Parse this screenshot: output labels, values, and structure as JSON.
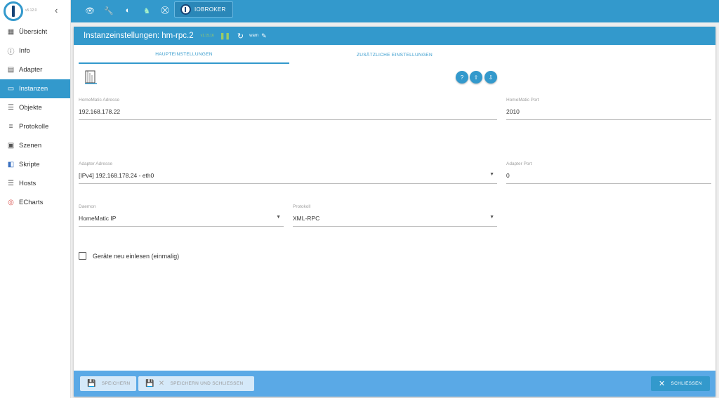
{
  "sidebar": {
    "version": "v5.12.0",
    "items": [
      {
        "label": "Übersicht",
        "icon": "grid-icon"
      },
      {
        "label": "Info",
        "icon": "info-icon"
      },
      {
        "label": "Adapter",
        "icon": "store-icon"
      },
      {
        "label": "Instanzen",
        "icon": "instances-icon"
      },
      {
        "label": "Objekte",
        "icon": "list-icon"
      },
      {
        "label": "Protokolle",
        "icon": "menu-icon"
      },
      {
        "label": "Szenen",
        "icon": "archive-icon"
      },
      {
        "label": "Skripte",
        "icon": "script-icon"
      },
      {
        "label": "Hosts",
        "icon": "storage-icon"
      },
      {
        "label": "ECharts",
        "icon": "echarts-icon"
      }
    ]
  },
  "topbar": {
    "brand": "IOBROKER",
    "icons": [
      "eye-icon",
      "wrench-icon",
      "brightness-icon",
      "expert-mode-icon",
      "no-connection-icon"
    ]
  },
  "panel": {
    "title": "Instanzeinstellungen: hm-rpc.2",
    "version": "v1.15.16",
    "log_level": "warn"
  },
  "tabs": [
    {
      "label": "HAUPTEINSTELLUNGEN",
      "active": true
    },
    {
      "label": "ZUSÄTZLICHE EINSTELLUNGEN",
      "active": false
    }
  ],
  "fields": {
    "homematic_address": {
      "label": "HomeMatic Adresse",
      "value": "192.168.178.22"
    },
    "homematic_port": {
      "label": "HomeMatic Port",
      "value": "2010"
    },
    "adapter_address": {
      "label": "Adapter Adresse",
      "value": "[IPv4] 192.168.178.24 - eth0"
    },
    "adapter_port": {
      "label": "Adapter Port",
      "value": "0"
    },
    "daemon": {
      "label": "Daemon",
      "value": "HomeMatic IP"
    },
    "protocol": {
      "label": "Protokoll",
      "value": "XML-RPC"
    }
  },
  "checkbox": {
    "label": "Geräte neu einlesen (einmalig)",
    "checked": false
  },
  "footer": {
    "save": "SPEICHERN",
    "save_close": "SPEICHERN UND SCHLIESSEN",
    "close": "SCHLIESSEN"
  },
  "colors": {
    "primary": "#3399cc",
    "accent_green": "#9ccc65",
    "footer": "#5aa9e6"
  }
}
